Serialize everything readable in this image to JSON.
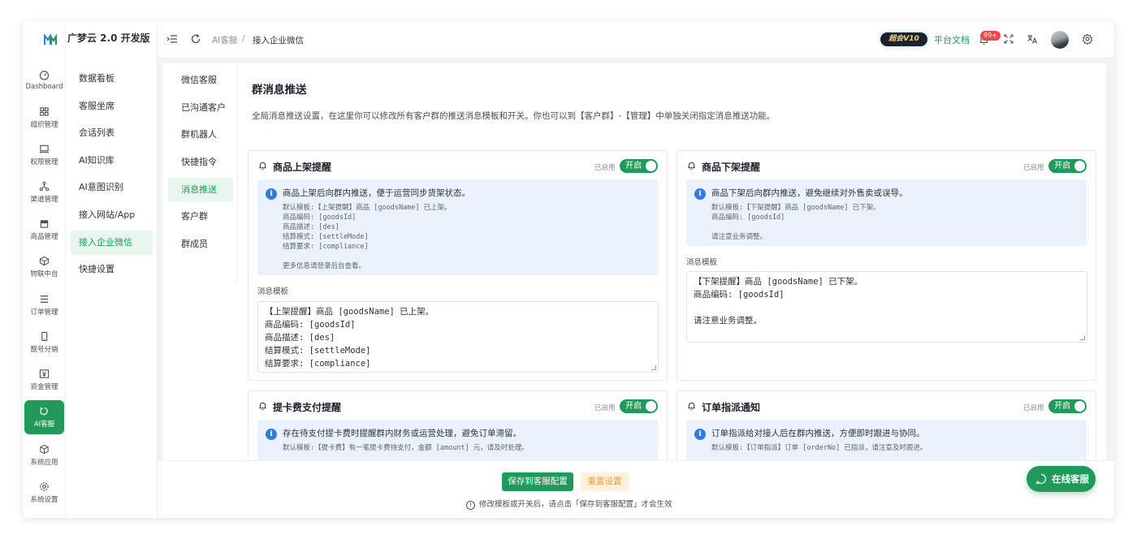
{
  "app": {
    "brand": "广梦云 2.0 开发版"
  },
  "rail": [
    {
      "label": "Dashboard",
      "icon": "dashboard-icon"
    },
    {
      "label": "组织管理",
      "icon": "grid-icon"
    },
    {
      "label": "权限管理",
      "icon": "monitor-icon"
    },
    {
      "label": "渠道管理",
      "icon": "network-icon"
    },
    {
      "label": "商品管理",
      "icon": "store-icon"
    },
    {
      "label": "物联中台",
      "icon": "cube-icon"
    },
    {
      "label": "订单管理",
      "icon": "list-icon"
    },
    {
      "label": "靓号分销",
      "icon": "phone-icon"
    },
    {
      "label": "资金管理",
      "icon": "yen-icon"
    },
    {
      "label": "AI客服",
      "icon": "ai-service-icon"
    },
    {
      "label": "系统应用",
      "icon": "box-icon"
    },
    {
      "label": "系统设置",
      "icon": "gear-icon"
    }
  ],
  "menu2": [
    {
      "label": "数据看板"
    },
    {
      "label": "客服坐席"
    },
    {
      "label": "会话列表"
    },
    {
      "label": "AI知识库"
    },
    {
      "label": "AI意图识别"
    },
    {
      "label": "接入网站/App"
    },
    {
      "label": "接入企业微信"
    },
    {
      "label": "快捷设置"
    }
  ],
  "topbar": {
    "crumb_root": "AI客服",
    "crumb_sep": "/",
    "crumb_current": "接入企业微信",
    "vip": "超会V10",
    "docs": "平台文档",
    "badge": "99+"
  },
  "menu3": [
    {
      "label": "微信客服"
    },
    {
      "label": "已沟通客户"
    },
    {
      "label": "群机器人"
    },
    {
      "label": "快捷指令"
    },
    {
      "label": "消息推送"
    },
    {
      "label": "客户群"
    },
    {
      "label": "群成员"
    }
  ],
  "main": {
    "title": "群消息推送",
    "desc": "全局消息推送设置，在这里你可以修改所有客户群的推送消息模板和开关。你也可以到【客户群】-【管理】中单独关闭指定消息推送功能。"
  },
  "cards": [
    {
      "title": "商品上架提醒",
      "enabled_label": "已启用",
      "toggle": "开启",
      "tip_head": "商品上架后向群内推送，便于运营同步货架状态。",
      "tip_lines": [
        "默认模板:【上架提醒】商品 [goodsName] 已上架。",
        "商品编码: [goodsId]",
        "商品描述: [des]",
        "结算模式: [settleMode]",
        "结算要求: [compliance]",
        "",
        "更多信息请登录后台查看。"
      ],
      "field_label": "消息模板",
      "template_lines": [
        "【上架提醒】商品 [goodsName] 已上架。",
        "商品编码: [goodsId]",
        "商品描述: [des]",
        "结算模式: [settleMode]",
        "结算要求: [compliance]"
      ]
    },
    {
      "title": "商品下架提醒",
      "enabled_label": "已启用",
      "toggle": "开启",
      "tip_head": "商品下架后向群内推送，避免继续对外售卖或误导。",
      "tip_lines": [
        "默认模板:【下架提醒】商品 [goodsName] 已下架。",
        "商品编码: [goodsId]",
        "",
        "请注意业务调整。"
      ],
      "field_label": "消息模板",
      "template_lines": [
        "【下架提醒】商品 [goodsName] 已下架。",
        "商品编码: [goodsId]",
        "",
        "请注意业务调整。"
      ]
    },
    {
      "title": "提卡费支付提醒",
      "enabled_label": "已启用",
      "toggle": "开启",
      "tip_head": "存在待支付提卡费时提醒群内财务或运营处理，避免订单滞留。",
      "tip_lines": [
        "默认模板:【提卡费】有一笔提卡费待支付，金额 [amount] 元，请及时处理。"
      ]
    },
    {
      "title": "订单指派通知",
      "enabled_label": "已启用",
      "toggle": "开启",
      "tip_head": "订单指派给对接人后在群内推送，方便即时跟进与协同。",
      "tip_lines": [
        "默认模板:【订单指派】订单 [orderNo] 已指派，请注意及时跟进。"
      ]
    }
  ],
  "bottom": {
    "save": "保存到客服配置",
    "reset": "重置设置",
    "note": "修改模板或开关后，请点击「保存到客服配置」才会生效"
  },
  "online_service": "在线客服",
  "colors": {
    "accent": "#1f9a5a",
    "info": "#2f7de1",
    "warning": "#e6a23c",
    "badge": "#f04848"
  }
}
